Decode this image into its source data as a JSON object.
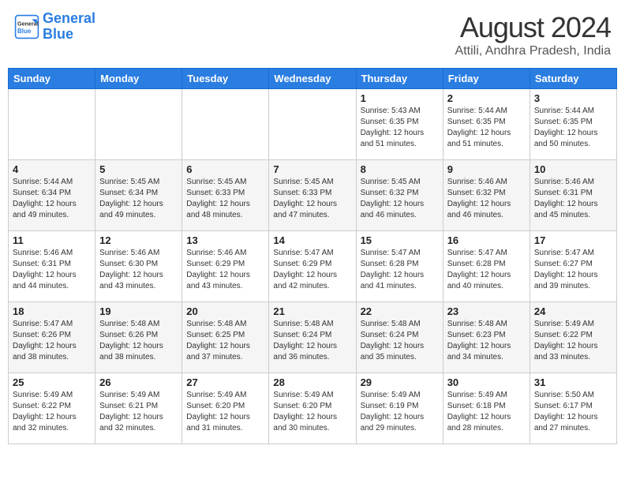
{
  "header": {
    "logo_line1": "General",
    "logo_line2": "Blue",
    "title": "August 2024",
    "subtitle": "Attili, Andhra Pradesh, India"
  },
  "days_of_week": [
    "Sunday",
    "Monday",
    "Tuesday",
    "Wednesday",
    "Thursday",
    "Friday",
    "Saturday"
  ],
  "weeks": [
    [
      {
        "day": "",
        "detail": ""
      },
      {
        "day": "",
        "detail": ""
      },
      {
        "day": "",
        "detail": ""
      },
      {
        "day": "",
        "detail": ""
      },
      {
        "day": "1",
        "detail": "Sunrise: 5:43 AM\nSunset: 6:35 PM\nDaylight: 12 hours\nand 51 minutes."
      },
      {
        "day": "2",
        "detail": "Sunrise: 5:44 AM\nSunset: 6:35 PM\nDaylight: 12 hours\nand 51 minutes."
      },
      {
        "day": "3",
        "detail": "Sunrise: 5:44 AM\nSunset: 6:35 PM\nDaylight: 12 hours\nand 50 minutes."
      }
    ],
    [
      {
        "day": "4",
        "detail": "Sunrise: 5:44 AM\nSunset: 6:34 PM\nDaylight: 12 hours\nand 49 minutes."
      },
      {
        "day": "5",
        "detail": "Sunrise: 5:45 AM\nSunset: 6:34 PM\nDaylight: 12 hours\nand 49 minutes."
      },
      {
        "day": "6",
        "detail": "Sunrise: 5:45 AM\nSunset: 6:33 PM\nDaylight: 12 hours\nand 48 minutes."
      },
      {
        "day": "7",
        "detail": "Sunrise: 5:45 AM\nSunset: 6:33 PM\nDaylight: 12 hours\nand 47 minutes."
      },
      {
        "day": "8",
        "detail": "Sunrise: 5:45 AM\nSunset: 6:32 PM\nDaylight: 12 hours\nand 46 minutes."
      },
      {
        "day": "9",
        "detail": "Sunrise: 5:46 AM\nSunset: 6:32 PM\nDaylight: 12 hours\nand 46 minutes."
      },
      {
        "day": "10",
        "detail": "Sunrise: 5:46 AM\nSunset: 6:31 PM\nDaylight: 12 hours\nand 45 minutes."
      }
    ],
    [
      {
        "day": "11",
        "detail": "Sunrise: 5:46 AM\nSunset: 6:31 PM\nDaylight: 12 hours\nand 44 minutes."
      },
      {
        "day": "12",
        "detail": "Sunrise: 5:46 AM\nSunset: 6:30 PM\nDaylight: 12 hours\nand 43 minutes."
      },
      {
        "day": "13",
        "detail": "Sunrise: 5:46 AM\nSunset: 6:29 PM\nDaylight: 12 hours\nand 43 minutes."
      },
      {
        "day": "14",
        "detail": "Sunrise: 5:47 AM\nSunset: 6:29 PM\nDaylight: 12 hours\nand 42 minutes."
      },
      {
        "day": "15",
        "detail": "Sunrise: 5:47 AM\nSunset: 6:28 PM\nDaylight: 12 hours\nand 41 minutes."
      },
      {
        "day": "16",
        "detail": "Sunrise: 5:47 AM\nSunset: 6:28 PM\nDaylight: 12 hours\nand 40 minutes."
      },
      {
        "day": "17",
        "detail": "Sunrise: 5:47 AM\nSunset: 6:27 PM\nDaylight: 12 hours\nand 39 minutes."
      }
    ],
    [
      {
        "day": "18",
        "detail": "Sunrise: 5:47 AM\nSunset: 6:26 PM\nDaylight: 12 hours\nand 38 minutes."
      },
      {
        "day": "19",
        "detail": "Sunrise: 5:48 AM\nSunset: 6:26 PM\nDaylight: 12 hours\nand 38 minutes."
      },
      {
        "day": "20",
        "detail": "Sunrise: 5:48 AM\nSunset: 6:25 PM\nDaylight: 12 hours\nand 37 minutes."
      },
      {
        "day": "21",
        "detail": "Sunrise: 5:48 AM\nSunset: 6:24 PM\nDaylight: 12 hours\nand 36 minutes."
      },
      {
        "day": "22",
        "detail": "Sunrise: 5:48 AM\nSunset: 6:24 PM\nDaylight: 12 hours\nand 35 minutes."
      },
      {
        "day": "23",
        "detail": "Sunrise: 5:48 AM\nSunset: 6:23 PM\nDaylight: 12 hours\nand 34 minutes."
      },
      {
        "day": "24",
        "detail": "Sunrise: 5:49 AM\nSunset: 6:22 PM\nDaylight: 12 hours\nand 33 minutes."
      }
    ],
    [
      {
        "day": "25",
        "detail": "Sunrise: 5:49 AM\nSunset: 6:22 PM\nDaylight: 12 hours\nand 32 minutes."
      },
      {
        "day": "26",
        "detail": "Sunrise: 5:49 AM\nSunset: 6:21 PM\nDaylight: 12 hours\nand 32 minutes."
      },
      {
        "day": "27",
        "detail": "Sunrise: 5:49 AM\nSunset: 6:20 PM\nDaylight: 12 hours\nand 31 minutes."
      },
      {
        "day": "28",
        "detail": "Sunrise: 5:49 AM\nSunset: 6:20 PM\nDaylight: 12 hours\nand 30 minutes."
      },
      {
        "day": "29",
        "detail": "Sunrise: 5:49 AM\nSunset: 6:19 PM\nDaylight: 12 hours\nand 29 minutes."
      },
      {
        "day": "30",
        "detail": "Sunrise: 5:49 AM\nSunset: 6:18 PM\nDaylight: 12 hours\nand 28 minutes."
      },
      {
        "day": "31",
        "detail": "Sunrise: 5:50 AM\nSunset: 6:17 PM\nDaylight: 12 hours\nand 27 minutes."
      }
    ]
  ]
}
